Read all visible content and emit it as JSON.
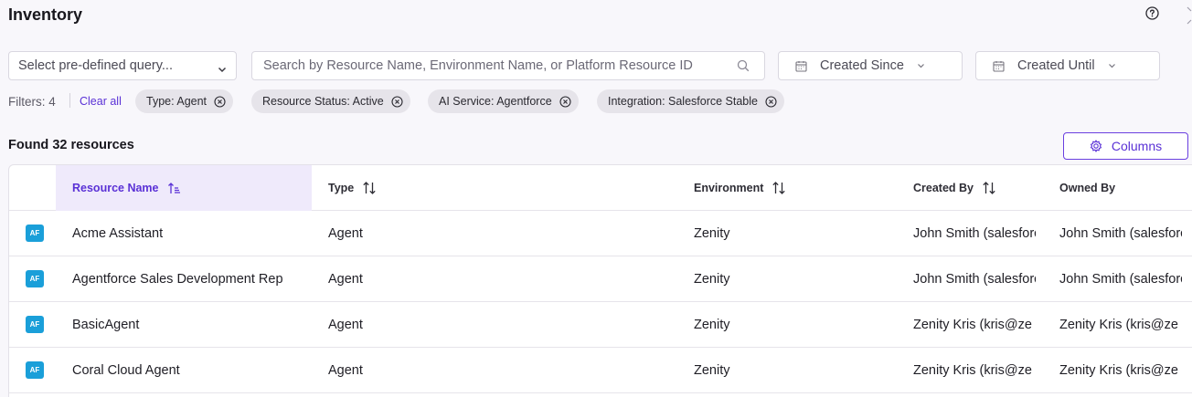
{
  "page": {
    "title": "Inventory"
  },
  "toolbar": {
    "query_placeholder": "Select pre-defined query...",
    "search_placeholder": "Search by Resource Name, Environment Name, or Platform Resource ID",
    "created_since": "Created Since",
    "created_until": "Created Until"
  },
  "filters": {
    "label": "Filters: 4",
    "clear_all": "Clear all",
    "chips": [
      "Type: Agent",
      "Resource Status: Active",
      "AI Service: Agentforce",
      "Integration: Salesforce Stable"
    ]
  },
  "results": {
    "found": "Found 32 resources",
    "columns_label": "Columns"
  },
  "table": {
    "headers": [
      "Resource Name",
      "Type",
      "Environment",
      "Created By",
      "Owned By"
    ],
    "rows": [
      {
        "badge": "AF",
        "name": "Acme Assistant",
        "type": "Agent",
        "environment": "Zenity",
        "created_by": "John Smith (salesforce",
        "owned_by": "John Smith (salesforce"
      },
      {
        "badge": "AF",
        "name": "Agentforce Sales Development Rep",
        "type": "Agent",
        "environment": "Zenity",
        "created_by": "John Smith (salesforce",
        "owned_by": "John Smith (salesforce"
      },
      {
        "badge": "AF",
        "name": "BasicAgent",
        "type": "Agent",
        "environment": "Zenity",
        "created_by": "Zenity Kris (kris@ze",
        "owned_by": "Zenity Kris (kris@ze"
      },
      {
        "badge": "AF",
        "name": "Coral Cloud Agent",
        "type": "Agent",
        "environment": "Zenity",
        "created_by": "Zenity Kris (kris@ze",
        "owned_by": "Zenity Kris (kris@ze"
      }
    ]
  },
  "icons": {
    "help": "help-circle-icon",
    "calendar": "calendar-icon",
    "chevron": "chevron-down-icon",
    "search": "search-icon",
    "close": "close-circle-icon",
    "gear": "gear-icon",
    "sort": "sort-arrows-icon",
    "sort_active": "sort-ascending-icon"
  },
  "colors": {
    "accent": "#5a31d6",
    "badge": "#1a9fd9",
    "chip_bg": "#e6e4ea",
    "active_header_bg": "#efeafb"
  }
}
